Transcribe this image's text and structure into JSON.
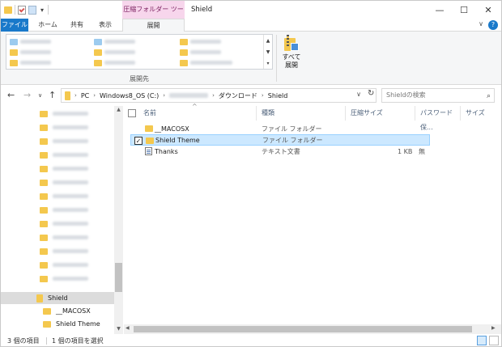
{
  "window": {
    "title": "Shield",
    "context_tab_title": "圧縮フォルダー ツール",
    "controls": {
      "minimize": "—",
      "maximize": "☐",
      "close": "✕"
    }
  },
  "ribbon": {
    "tabs": [
      {
        "label": "ファイル"
      },
      {
        "label": "ホーム"
      },
      {
        "label": "共有"
      },
      {
        "label": "表示"
      },
      {
        "label": "展開"
      }
    ],
    "collapse_glyph": "∨",
    "help_glyph": "?",
    "extract_group_label": "展開先",
    "extract_all_label_1": "すべて",
    "extract_all_label_2": "展開"
  },
  "address": {
    "segments": [
      "PC",
      "Windows8_OS (C:)",
      "ダウンロード",
      "Shield"
    ],
    "separator": "›",
    "search_placeholder": "Shieldの検索"
  },
  "nav_pane": {
    "items": [
      {
        "label": "Shield",
        "selected": true
      },
      {
        "label": "__MACOSX",
        "selected": false
      },
      {
        "label": "Shield Theme",
        "selected": false
      }
    ]
  },
  "file_list": {
    "columns": {
      "name": "名前",
      "type": "種類",
      "compressed_size": "圧縮サイズ",
      "password": "パスワード保...",
      "size": "サイズ"
    },
    "rows": [
      {
        "name": "__MACOSX",
        "type": "ファイル フォルダー",
        "size": "",
        "password": "",
        "icon": "folder-icon",
        "selected": false
      },
      {
        "name": "Shield Theme",
        "type": "ファイル フォルダー",
        "size": "",
        "password": "",
        "icon": "folder-icon",
        "selected": true
      },
      {
        "name": "Thanks",
        "type": "テキスト文書",
        "size": "1 KB",
        "password": "無",
        "icon": "text-file-icon",
        "selected": false
      }
    ]
  },
  "status": {
    "item_count": "3 個の項目",
    "selected_count": "1 個の項目を選択"
  },
  "colors": {
    "file_tab": "#1979ca",
    "context_tab": "#f7d6ec",
    "selection": "#cce8ff",
    "folder": "#f4c84e"
  }
}
